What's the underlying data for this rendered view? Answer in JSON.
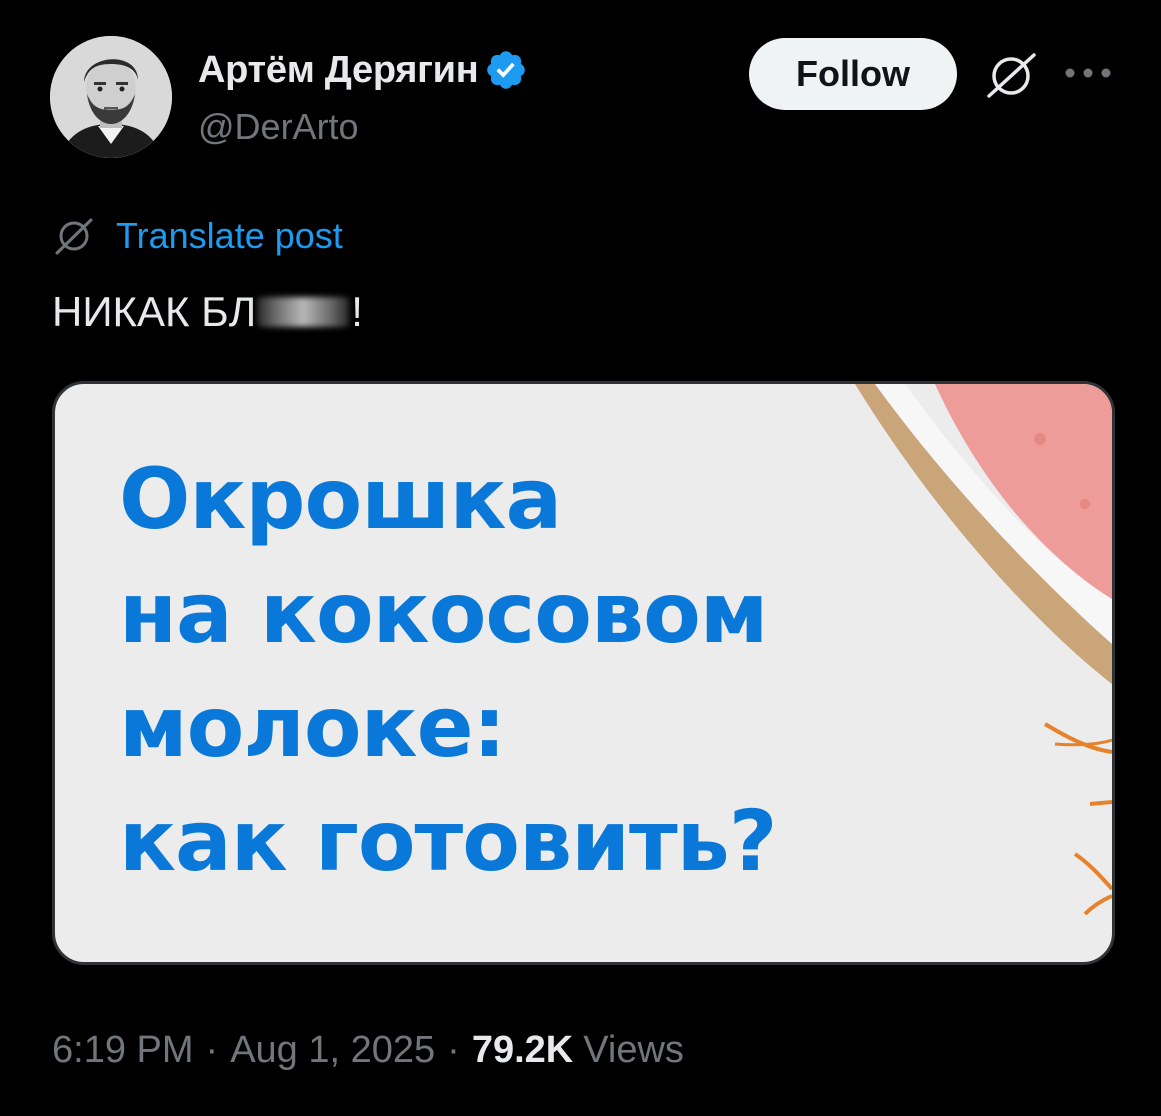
{
  "author": {
    "display_name": "Артём Дерягин",
    "handle": "@DerArto",
    "verified": true,
    "avatar_icon": "person-portrait-avatar"
  },
  "actions": {
    "follow_label": "Follow",
    "grok_icon": "grok-icon",
    "more_icon": "more-dots-icon"
  },
  "post": {
    "translate_label": "Translate post",
    "text_start": "НИКАК БЛ",
    "text_end": "!"
  },
  "media": {
    "headline_lines": [
      "Окрошка",
      "на кокосовом",
      "молоке:",
      "как готовить?"
    ]
  },
  "meta": {
    "time": "6:19 PM",
    "separator": "·",
    "date": "Aug 1, 2025",
    "views_count": "79.2K",
    "views_label": "Views"
  },
  "colors": {
    "background": "#000000",
    "primary_text": "#e7e9ea",
    "secondary_text": "#71767b",
    "link": "#1d9bf0",
    "headline": "#0a78d8"
  }
}
